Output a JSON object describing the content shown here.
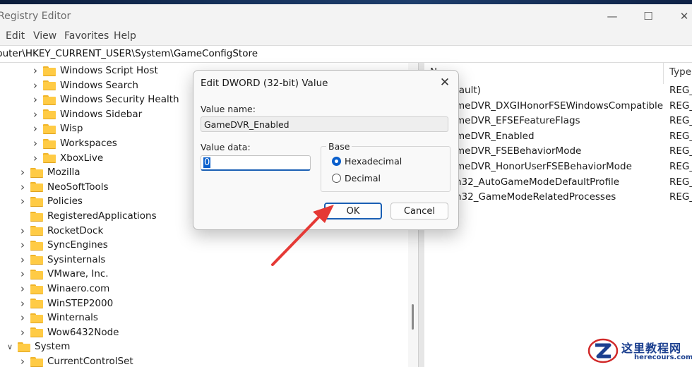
{
  "window": {
    "title": "Registry Editor",
    "minimize_icon": "minimize-icon",
    "maximize_icon": "maximize-icon",
    "close_icon": "close-icon"
  },
  "menu": [
    "Edit",
    "View",
    "Favorites",
    "Help"
  ],
  "address": "puter\\HKEY_CURRENT_USER\\System\\GameConfigStore",
  "tree": {
    "nested_items": [
      {
        "label": "Windows Script Host",
        "expandable": true
      },
      {
        "label": "Windows Search",
        "expandable": true
      },
      {
        "label": "Windows Security Health",
        "expandable": true
      },
      {
        "label": "Windows Sidebar",
        "expandable": true
      },
      {
        "label": "Wisp",
        "expandable": true
      },
      {
        "label": "Workspaces",
        "expandable": true
      },
      {
        "label": "XboxLive",
        "expandable": true
      }
    ],
    "software_items": [
      {
        "label": "Mozilla",
        "expandable": true
      },
      {
        "label": "NeoSoftTools",
        "expandable": true
      },
      {
        "label": "Policies",
        "expandable": true
      },
      {
        "label": "RegisteredApplications",
        "expandable": false
      },
      {
        "label": "RocketDock",
        "expandable": true
      },
      {
        "label": "SyncEngines",
        "expandable": true
      },
      {
        "label": "Sysinternals",
        "expandable": true
      },
      {
        "label": "VMware, Inc.",
        "expandable": true
      },
      {
        "label": "Winaero.com",
        "expandable": true
      },
      {
        "label": "WinSTEP2000",
        "expandable": true
      },
      {
        "label": "Winternals",
        "expandable": true
      },
      {
        "label": "Wow6432Node",
        "expandable": true
      }
    ],
    "system": {
      "label": "System",
      "expanded": true
    },
    "system_children": [
      {
        "label": "CurrentControlSet",
        "expandable": true
      }
    ]
  },
  "list": {
    "col_name": "N",
    "col_type": "Type",
    "rows": [
      {
        "name": "fault)",
        "type": "REG_"
      },
      {
        "name": "meDVR_DXGIHonorFSEWindowsCompatible",
        "type": "REG_"
      },
      {
        "name": "meDVR_EFSEFeatureFlags",
        "type": "REG_"
      },
      {
        "name": "meDVR_Enabled",
        "type": "REG_"
      },
      {
        "name": "meDVR_FSEBehaviorMode",
        "type": "REG_"
      },
      {
        "name": "meDVR_HonorUserFSEBehaviorMode",
        "type": "REG_"
      },
      {
        "name": "n32_AutoGameModeDefaultProfile",
        "type": "REG_"
      },
      {
        "name": "n32_GameModeRelatedProcesses",
        "type": "REG_"
      }
    ]
  },
  "dialog": {
    "title": "Edit DWORD (32-bit) Value",
    "value_name_label": "Value name:",
    "value_name": "GameDVR_Enabled",
    "value_data_label": "Value data:",
    "value_data": "0",
    "base_label": "Base",
    "base_options": [
      {
        "label": "Hexadecimal",
        "selected": true
      },
      {
        "label": "Decimal",
        "selected": false
      }
    ],
    "ok_label": "OK",
    "cancel_label": "Cancel"
  },
  "annotation": {
    "color": "#e53935",
    "icon": "pointer-arrow-icon"
  },
  "watermark": {
    "cn": "这里教程网",
    "en": "herecours.com"
  }
}
